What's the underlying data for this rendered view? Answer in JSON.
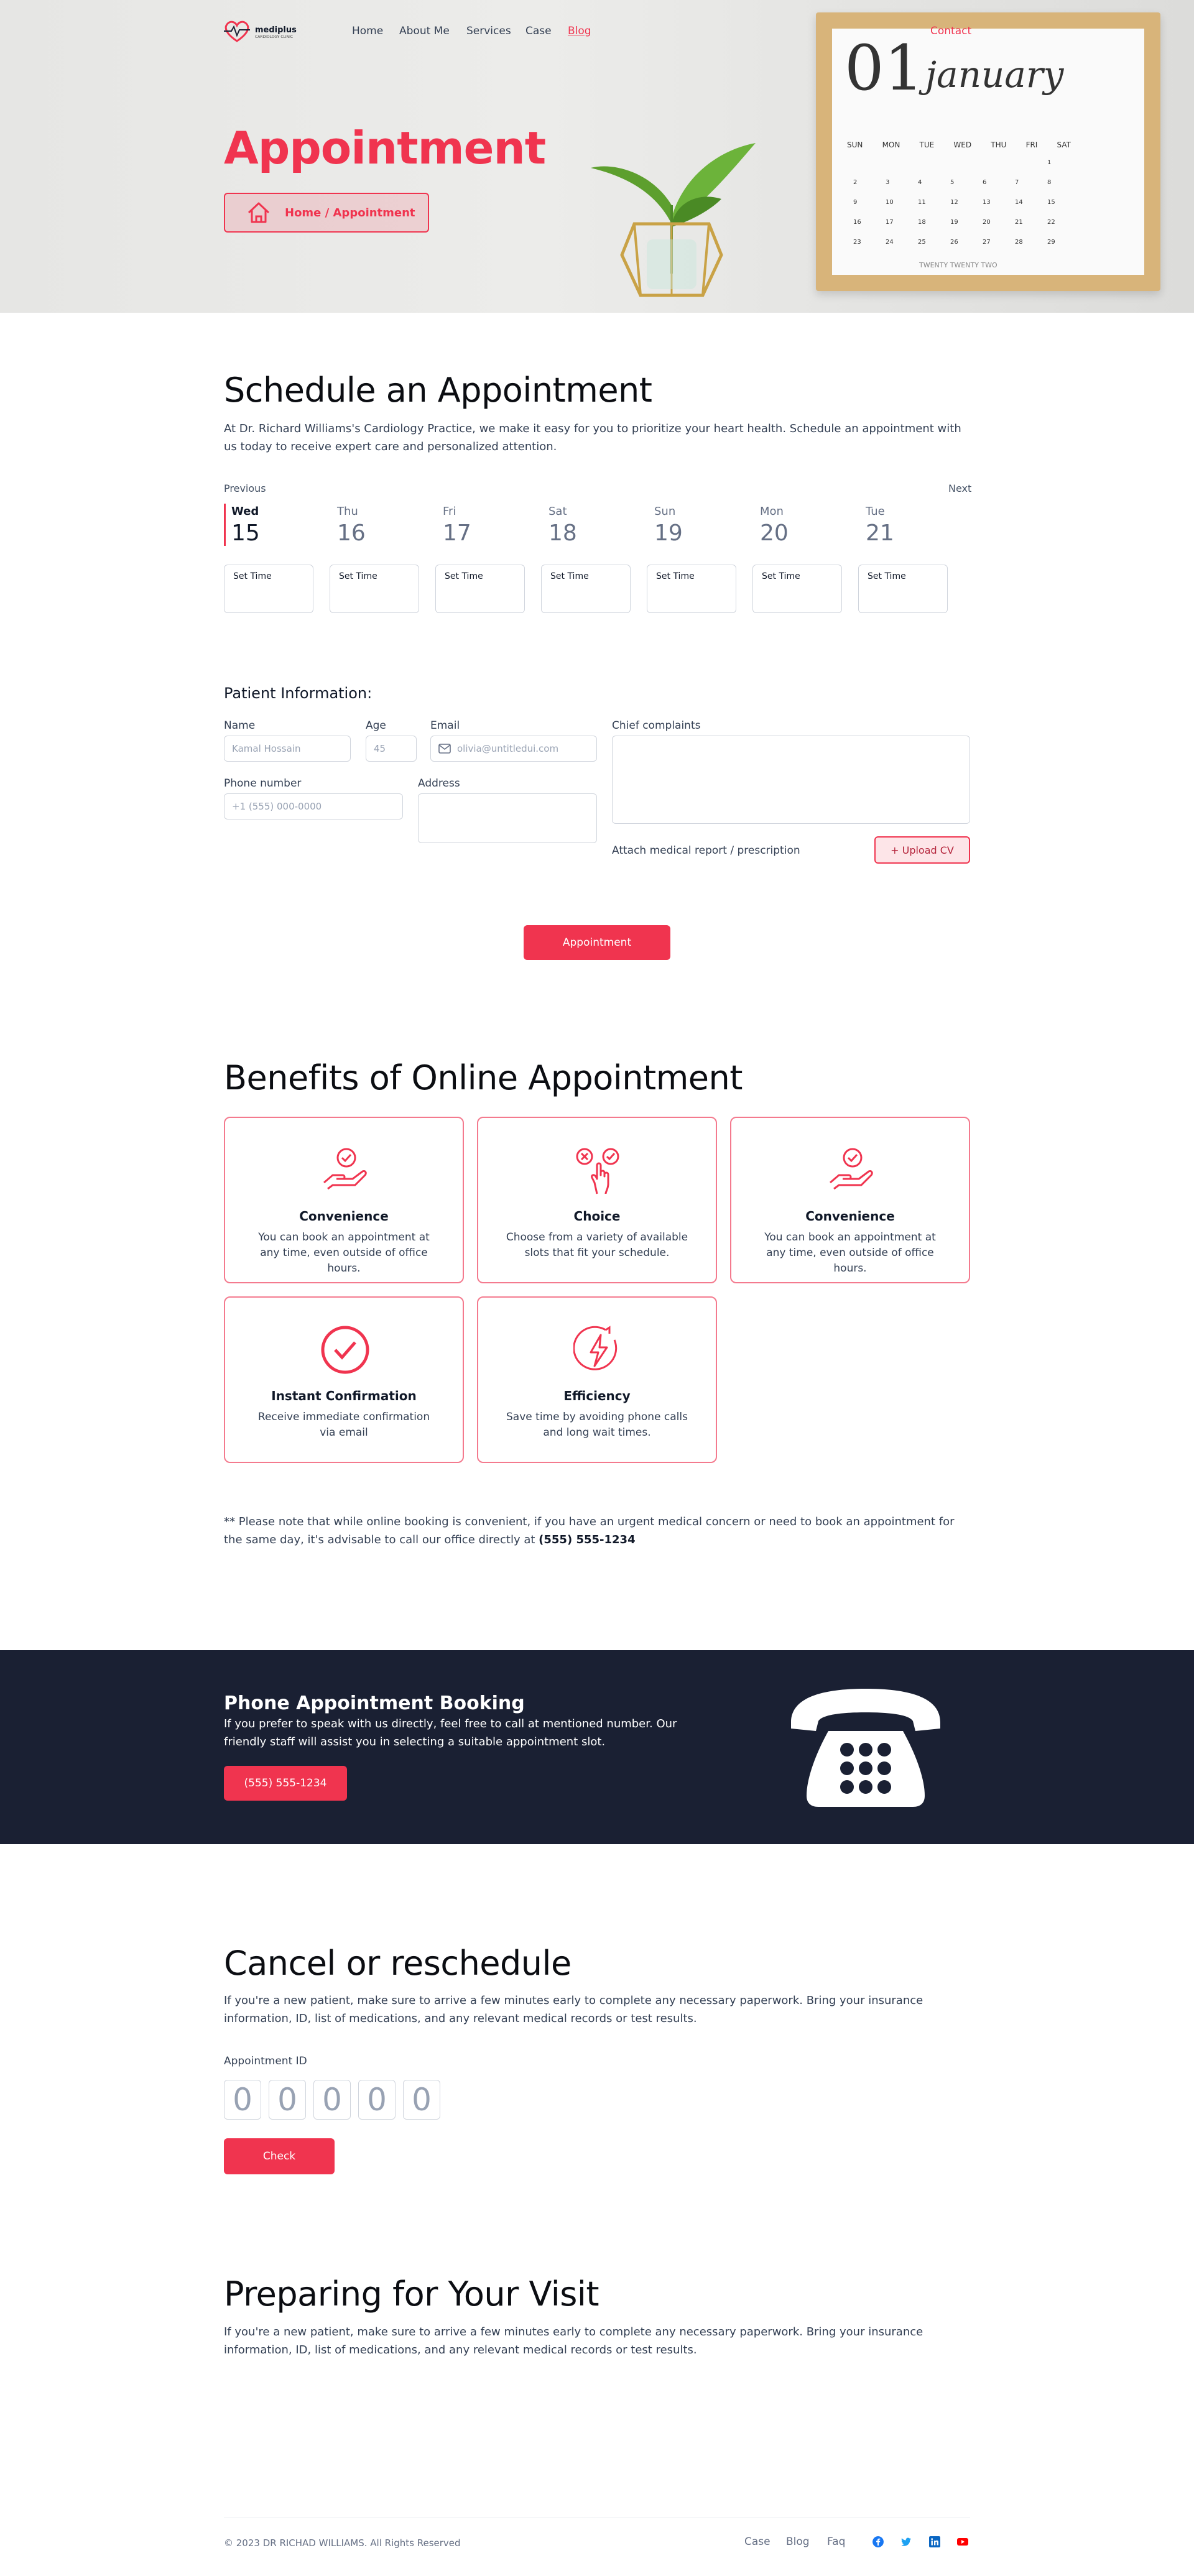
{
  "header": {
    "brand": "mediplus",
    "brand_sub": "CARDIOLOGY CLINIC",
    "nav": [
      "Home",
      "About Me",
      "Services",
      "Case",
      "Blog",
      "Contact"
    ]
  },
  "hero": {
    "title": "Appointment",
    "breadcrumb": "Home / Appointment"
  },
  "calendar_photo": {
    "day": "01",
    "month": "january",
    "weekdays": [
      "SUN",
      "MON",
      "TUE",
      "WED",
      "THU",
      "FRI",
      "SAT"
    ],
    "footer": "TWENTY TWENTY TWO"
  },
  "schedule": {
    "title": "Schedule an Appointment",
    "description": "At Dr. Richard Williams's Cardiology Practice, we make it easy for you to prioritize your heart health. Schedule an appointment with us today to receive expert care and personalized attention.",
    "prev_label": "Previous",
    "next_label": "Next",
    "days": [
      {
        "name": "Wed",
        "num": "15",
        "active": true
      },
      {
        "name": "Thu",
        "num": "16",
        "active": false
      },
      {
        "name": "Fri",
        "num": "17",
        "active": false
      },
      {
        "name": "Sat",
        "num": "18",
        "active": false
      },
      {
        "name": "Sun",
        "num": "19",
        "active": false
      },
      {
        "name": "Mon",
        "num": "20",
        "active": false
      },
      {
        "name": "Tue",
        "num": "21",
        "active": false
      }
    ],
    "set_time_label": "Set Time"
  },
  "patient": {
    "title": "Patient Information:",
    "name_label": "Name",
    "name_placeholder": "Kamal Hossain",
    "age_label": "Age",
    "age_placeholder": "45",
    "email_label": "Email",
    "email_placeholder": "olivia@untitledui.com",
    "complaints_label": "Chief complaints",
    "phone_label": "Phone number",
    "phone_placeholder": "+1 (555) 000-0000",
    "address_label": "Address",
    "attach_label": "Attach medical report / prescription",
    "upload_label": "+ Upload CV",
    "submit_label": "Appointment"
  },
  "benefits": {
    "title": "Benefits of Online Appointment",
    "cards": [
      {
        "title": "Convenience",
        "text": "You can book an appointment at any time, even outside of office hours.",
        "icon": "hand-check-icon"
      },
      {
        "title": "Choice",
        "text": "Choose from a variety of available slots that fit your schedule.",
        "icon": "choice-hand-icon"
      },
      {
        "title": "Convenience",
        "text": "You can book an appointment at any time, even outside of office hours.",
        "icon": "hand-check-icon"
      },
      {
        "title": "Instant Confirmation",
        "text": "Receive immediate confirmation via email",
        "icon": "check-circle-icon"
      },
      {
        "title": "Efficiency",
        "text": "Save time by avoiding phone calls and long wait times.",
        "icon": "lightning-icon"
      }
    ],
    "note": "** Please note that while online booking is convenient, if you have an urgent medical concern or need to book an appointment for the same day, it's advisable to call our office directly at",
    "note_phone": "(555) 555-1234"
  },
  "phone_booking": {
    "title": "Phone Appointment Booking",
    "text": "If you prefer to speak with us directly, feel free to call at mentioned number. Our friendly staff will assist you in selecting a suitable appointment slot.",
    "button": "(555) 555-1234"
  },
  "cancel": {
    "title": "Cancel or reschedule",
    "text": "If you're a new patient, make sure to arrive a few minutes early to complete any necessary paperwork. Bring your insurance information, ID, list of medications, and any relevant medical records or test results.",
    "id_label": "Appointment ID",
    "digits": [
      "0",
      "0",
      "0",
      "0",
      "0"
    ],
    "check_label": "Check"
  },
  "preparing": {
    "title": "Preparing for Your Visit",
    "text": "If you're a new patient, make sure to arrive a few minutes early to complete any necessary paperwork. Bring your insurance information, ID, list of medications, and any relevant medical records or test results."
  },
  "footer": {
    "copyright": "© 2023 DR RICHAD WILLIAMS. All Rights Reserved",
    "links": [
      "Case",
      "Blog",
      "Faq"
    ],
    "social": [
      "facebook-icon",
      "twitter-icon",
      "linkedin-icon",
      "youtube-icon"
    ]
  },
  "colors": {
    "accent": "#f0344f",
    "dark": "#1a2033"
  }
}
